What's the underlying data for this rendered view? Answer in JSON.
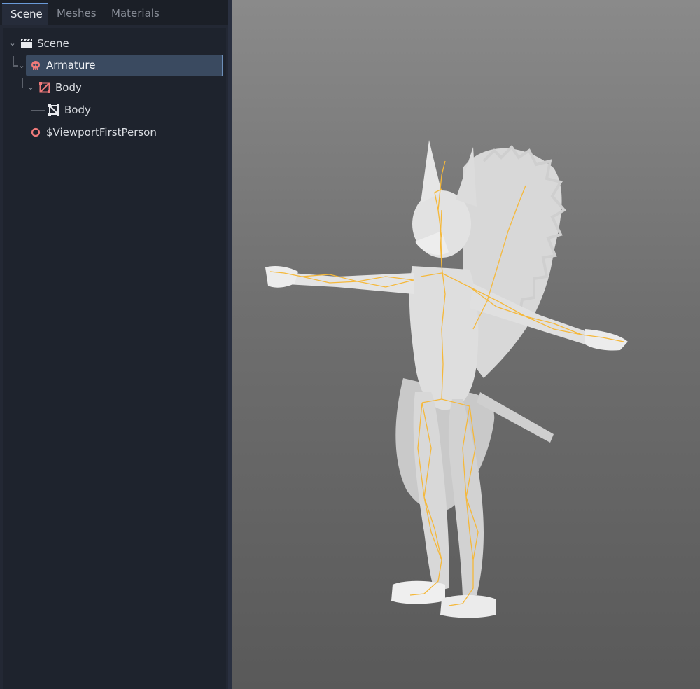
{
  "tabs": [
    {
      "label": "Scene",
      "active": true
    },
    {
      "label": "Meshes",
      "active": false
    },
    {
      "label": "Materials",
      "active": false
    }
  ],
  "tree": [
    {
      "label": "Scene",
      "icon": "clapperboard-icon",
      "expanded": true
    },
    {
      "label": "Armature",
      "icon": "skull-icon",
      "expanded": true,
      "selected": true
    },
    {
      "label": "Body",
      "icon": "mesh-instance-icon",
      "expanded": true
    },
    {
      "label": "Body",
      "icon": "mesh-icon"
    },
    {
      "label": "$ViewportFirstPerson",
      "icon": "node3d-icon"
    }
  ],
  "viewport": {
    "content": "squirrel-character-model-with-skeleton"
  },
  "colors": {
    "accent": "#6a9ad8",
    "selection": "#3a4a60",
    "node_icon": "#f07a7a",
    "bone": "#f5b83a"
  }
}
